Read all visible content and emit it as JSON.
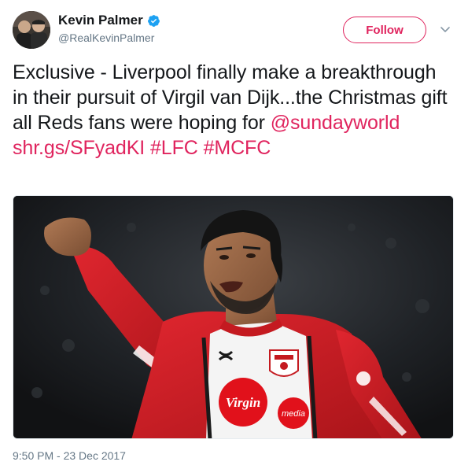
{
  "author": {
    "display_name": "Kevin Palmer",
    "handle": "@RealKevinPalmer",
    "verified": true,
    "avatar_icon": "avatar-photo"
  },
  "header": {
    "follow_label": "Follow",
    "caret_icon": "chevron-down-icon"
  },
  "tweet": {
    "text_part1": "Exclusive - Liverpool finally make a breakthrough in their pursuit of Virgil van Dijk...the Christmas gift all Reds fans were hoping for ",
    "mention": "@sundayworld",
    "link": "shr.gs/SFyadKI",
    "hashtag1": "#LFC",
    "hashtag2": "#MCFC"
  },
  "media": {
    "shirt_sponsor": "Virgin",
    "shirt_sponsor_sub": "media"
  },
  "timestamp": "9:50 PM - 23 Dec 2017",
  "colors": {
    "accent": "#e0245e",
    "verified_blue": "#1da1f2",
    "text": "#14171a",
    "secondary": "#657786"
  }
}
